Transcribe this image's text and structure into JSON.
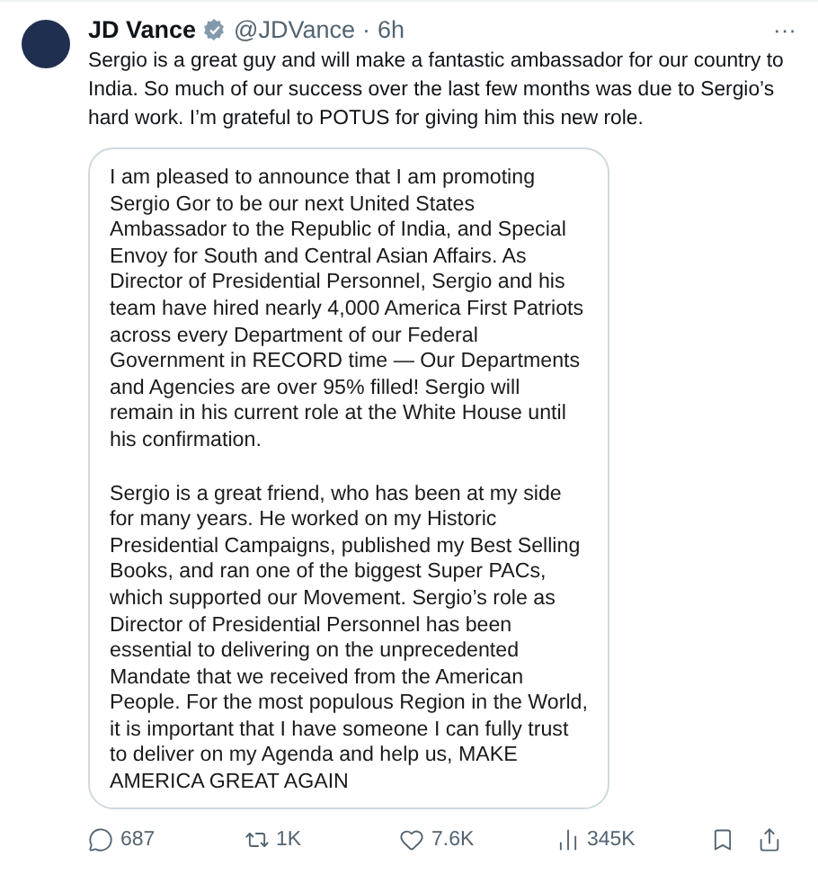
{
  "author": {
    "name": "JD Vance",
    "verified": true,
    "handle": "@JDVance",
    "separator": "·",
    "time": "6h"
  },
  "more": "···",
  "text": "Sergio is a great guy and will make a fantastic ambassador for our country to India. So much of our success over the last few months was due to Sergio’s hard work. I’m grateful to POTUS for giving him this new role.",
  "statement": {
    "paragraphs": [
      "I am pleased to announce that I am promoting Sergio Gor to be our next United States Ambassador to the Republic of India, and Special Envoy for South and Central Asian Affairs. As Director of Presidential Personnel, Sergio and his team have hired nearly 4,000 America First Patriots across every Department of our Federal Government in RECORD time — Our Departments and Agencies are over 95% filled! Sergio will remain in his current role at the White House until his confirmation.",
      "Sergio is a great friend, who has been at my side for many years. He worked on my Historic Presidential Campaigns, published my Best Selling Books, and ran one of the biggest Super PACs, which supported our Movement. Sergio’s role as Director of Presidential Personnel has been essential to delivering on the unprecedented Mandate that we received from the American People. For the most populous Region in the World, it is important that I have someone I can fully trust to deliver on my Agenda and help us, MAKE AMERICA GREAT AGAIN"
    ]
  },
  "actions": [
    {
      "kind": "reply",
      "count": "687"
    },
    {
      "kind": "repost",
      "count": "1K"
    },
    {
      "kind": "like",
      "count": "7.6K"
    },
    {
      "kind": "views",
      "count": "345K"
    },
    {
      "kind": "bookmark"
    },
    {
      "kind": "share"
    }
  ]
}
